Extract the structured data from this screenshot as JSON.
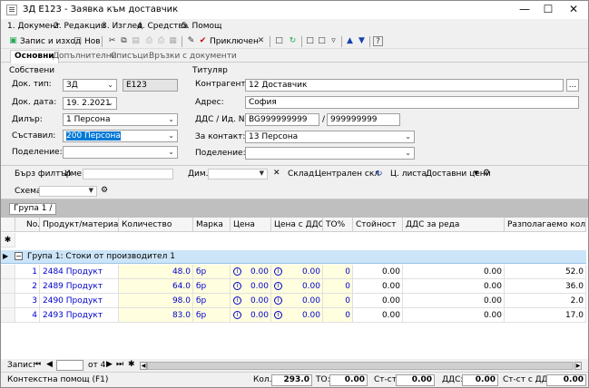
{
  "window": {
    "title": "ЗД E123 - Заявка към доставчик"
  },
  "menu": [
    "1. Документ",
    "2. Редакция",
    "3. Изглед",
    "4. Средства",
    "5. Помощ"
  ],
  "toolbar": {
    "save_label": "Запис и изход",
    "new_label": "Нов",
    "approved_label": "Приключен"
  },
  "tabs": [
    "Основни",
    "Допълнителни",
    "Списъци",
    "Връзки с документи"
  ],
  "owners": {
    "title": "Собствени",
    "doc_type_label": "Док. тип:",
    "doc_type": "ЗД",
    "doc_no": "E123",
    "doc_date_label": "Док. дата:",
    "doc_date": "19. 2.2021",
    "dealer_label": "Дилър:",
    "dealer": "1 Персона",
    "composed_label": "Съставил:",
    "composed": "200 Персона",
    "division_label": "Поделение:",
    "division": ""
  },
  "holder": {
    "title": "Титуляр",
    "counterparty_label": "Контрагент:",
    "counterparty": "12 Доставчик",
    "address_label": "Адрес:",
    "address": "София",
    "vat_label": "ДДС / Ид. No.",
    "vat_no": "BG999999999",
    "vat_sep": "/",
    "id_no": "999999999",
    "contact_label": "За контакт:",
    "contact": "13 Персона",
    "division_label": "Поделение:",
    "division": ""
  },
  "filters": {
    "quick_filter": "Бърз филтър",
    "name_label": "Име:",
    "dim_label": "Дим.",
    "warehouse_label": "Склад:",
    "warehouse": "Централен скл",
    "pricelist_label": "Ц. листа:",
    "pricelist": "Доставни цени",
    "scheme_label": "Схема:"
  },
  "group_chip": "Група 1 ∕",
  "grid": {
    "headers": [
      "No.",
      "Продукт/материал",
      "Количество",
      "Марка",
      "Цена",
      "Цена с ДДС",
      "ТО%",
      "Стойност",
      "ДДС за реда",
      "Разполагаемо кол."
    ],
    "group_label": "Група 1: Стоки от производител 1",
    "rows": [
      {
        "no": "1",
        "product": "2484 Продукт",
        "qty": "48.0",
        "unit": "бр",
        "price": "0.00",
        "price_vat": "0.00",
        "to": "0",
        "value": "0.00",
        "vat": "0.00",
        "avail": "52.0"
      },
      {
        "no": "2",
        "product": "2489 Продукт",
        "qty": "64.0",
        "unit": "бр",
        "price": "0.00",
        "price_vat": "0.00",
        "to": "0",
        "value": "0.00",
        "vat": "0.00",
        "avail": "36.0"
      },
      {
        "no": "3",
        "product": "2490 Продукт",
        "qty": "98.0",
        "unit": "бр",
        "price": "0.00",
        "price_vat": "0.00",
        "to": "0",
        "value": "0.00",
        "vat": "0.00",
        "avail": "2.0"
      },
      {
        "no": "4",
        "product": "2493 Продукт",
        "qty": "83.0",
        "unit": "бр",
        "price": "0.00",
        "price_vat": "0.00",
        "to": "0",
        "value": "0.00",
        "vat": "0.00",
        "avail": "17.0"
      }
    ]
  },
  "nav": {
    "record_label": "Запис:",
    "of": "от 4"
  },
  "status": {
    "help": "Контекстна помощ (F1)",
    "qty_label": "Кол.",
    "qty": "293.0",
    "to_label": "ТО:",
    "to": "0.00",
    "value_label": "Ст-ст:",
    "value": "0.00",
    "vat_label": "ДДС:",
    "vat": "0.00",
    "value_vat_label": "Ст-ст с ДДС:",
    "value_vat": "0.00"
  }
}
